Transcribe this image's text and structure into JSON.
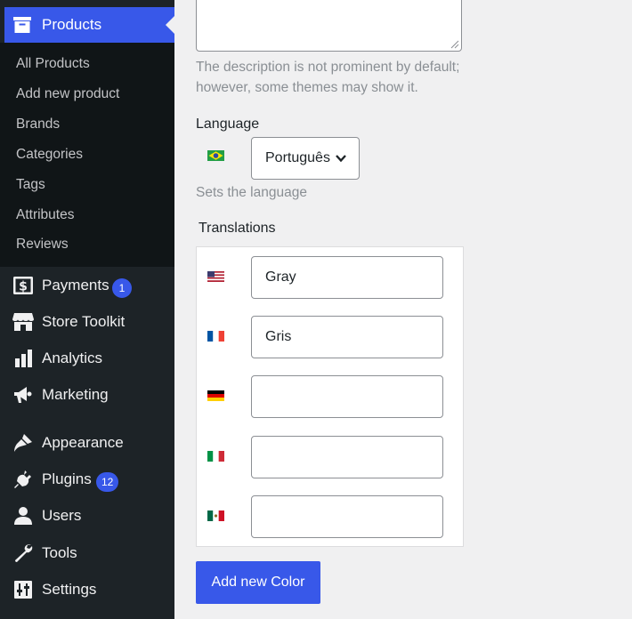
{
  "sidebar": {
    "active": {
      "label": "Products",
      "icon": "archive-icon"
    },
    "submenu": [
      "All Products",
      "Add new product",
      "Brands",
      "Categories",
      "Tags",
      "Attributes",
      "Reviews"
    ],
    "items": [
      {
        "label": "Payments",
        "icon": "payments-icon",
        "badge": "1"
      },
      {
        "label": "Store Toolkit",
        "icon": "storefront-icon"
      },
      {
        "label": "Analytics",
        "icon": "bar-chart-icon"
      },
      {
        "label": "Marketing",
        "icon": "megaphone-icon"
      },
      {
        "label": "Appearance",
        "icon": "paintbrush-icon"
      },
      {
        "label": "Plugins",
        "icon": "plug-icon",
        "badge": "12"
      },
      {
        "label": "Users",
        "icon": "user-icon"
      },
      {
        "label": "Tools",
        "icon": "wrench-icon"
      },
      {
        "label": "Settings",
        "icon": "sliders-icon"
      }
    ]
  },
  "main": {
    "description_help": "The description is not prominent by default; however, some themes may show it.",
    "language": {
      "label": "Language",
      "selected": "Português",
      "help": "Sets the language",
      "flag": "brazil-flag-icon"
    },
    "translations": {
      "label": "Translations",
      "rows": [
        {
          "flag": "us-flag-icon",
          "value": "Gray"
        },
        {
          "flag": "france-flag-icon",
          "value": "Gris"
        },
        {
          "flag": "germany-flag-icon",
          "value": ""
        },
        {
          "flag": "italy-flag-icon",
          "value": ""
        },
        {
          "flag": "mexico-flag-icon",
          "value": ""
        }
      ]
    },
    "add_button": "Add new Color"
  },
  "colors": {
    "accent": "#3858e9",
    "sidebar": "#1d2327",
    "submenu": "#101517"
  }
}
